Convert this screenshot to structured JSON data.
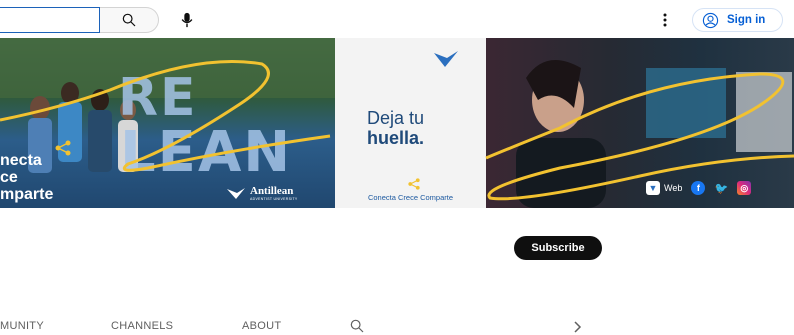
{
  "header": {
    "search_placeholder": "",
    "search_icon": "search-icon",
    "mic_icon": "mic-icon",
    "more_icon": "more-vert-icon",
    "signin_label": "Sign in",
    "accent_color": "#065fd4"
  },
  "banner": {
    "left": {
      "big_text_1": "RE",
      "big_text_2": "LEAN",
      "slogan_1": "necta",
      "slogan_2": "ce",
      "slogan_3": "mparte",
      "logo_name": "Antillean",
      "logo_sub": "ADVENTIST UNIVERSITY"
    },
    "middle": {
      "line1": "Deja tu",
      "line2": "huella.",
      "footer": "Conecta Crece Comparte"
    },
    "right": {
      "web_label": "Web"
    },
    "accent_yellow": "#f2c230"
  },
  "channel": {
    "subscribe_label": "Subscribe"
  },
  "tabs": {
    "community": "MUNITY",
    "channels": "CHANNELS",
    "about": "ABOUT",
    "search_icon": "search-icon",
    "next_icon": "chevron-right-icon"
  }
}
